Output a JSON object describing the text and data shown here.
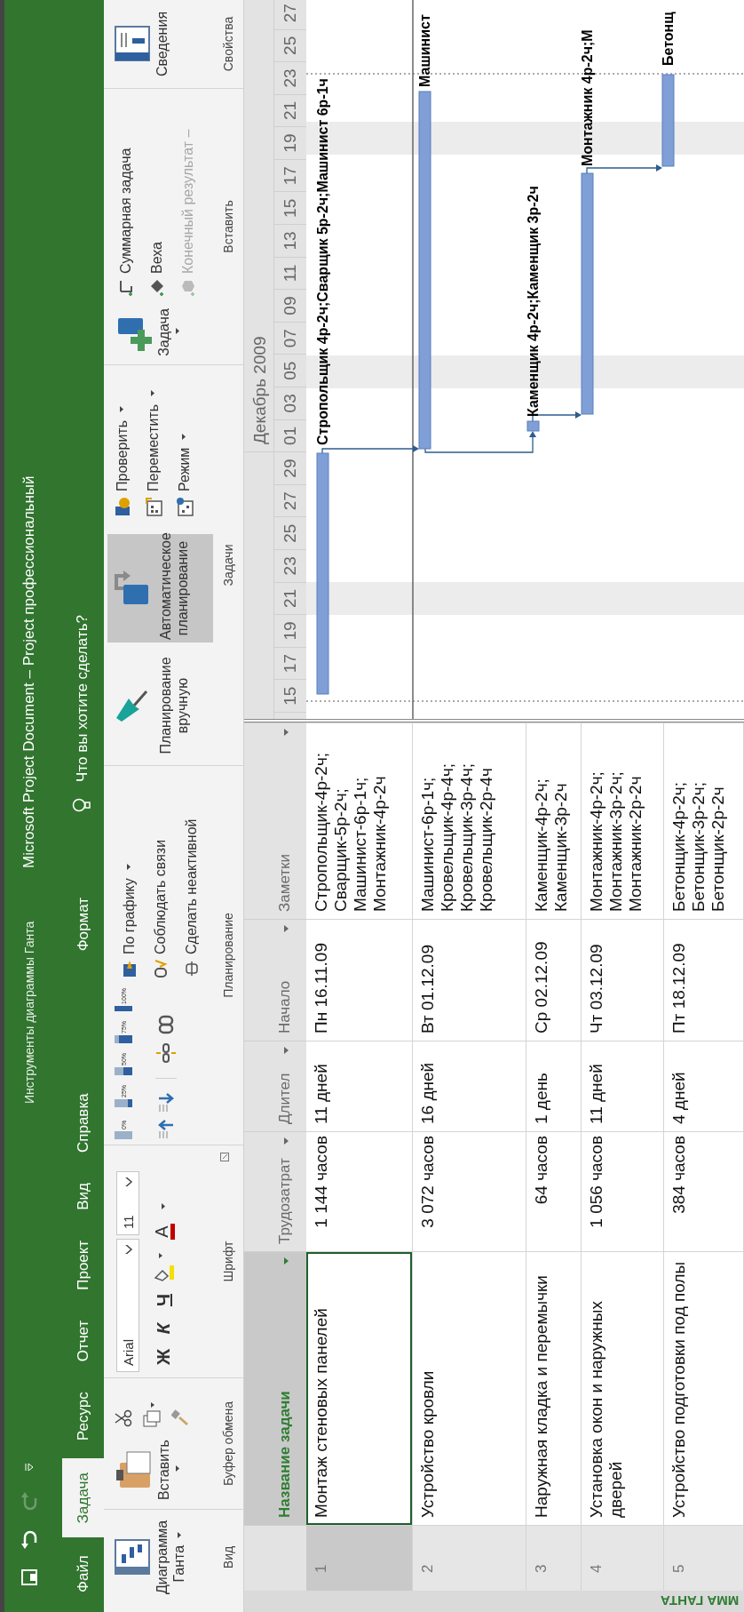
{
  "window": {
    "title": "Microsoft Project Document – Project профессиональный",
    "context_group": "Инструменты диаграммы Ганта"
  },
  "quick_access": [
    {
      "kind": "save",
      "disabled": false
    },
    {
      "kind": "undo",
      "disabled": false
    },
    {
      "kind": "redo",
      "disabled": true
    },
    {
      "kind": "customize",
      "disabled": false
    }
  ],
  "tabs": [
    {
      "label": "Файл",
      "kind": "normal",
      "selected": false
    },
    {
      "label": "Задача",
      "kind": "normal",
      "selected": true
    },
    {
      "label": "Ресурс",
      "kind": "normal",
      "selected": false
    },
    {
      "label": "Отчет",
      "kind": "normal",
      "selected": false
    },
    {
      "label": "Проект",
      "kind": "normal",
      "selected": false
    },
    {
      "label": "Вид",
      "kind": "normal",
      "selected": false
    },
    {
      "label": "Справка",
      "kind": "normal",
      "selected": false
    },
    {
      "label": "Формат",
      "kind": "context",
      "selected": false
    }
  ],
  "search": {
    "placeholder": "Что вы хотите сделать?"
  },
  "ribbon": {
    "view_group": {
      "label": "Вид",
      "gantt_button": "Диаграмма Ганта"
    },
    "clipboard_group": {
      "label": "Буфер обмена",
      "paste_button": "Вставить"
    },
    "font_group": {
      "label": "Шрифт",
      "font_name": "Arial",
      "font_size": "11",
      "bold": "Ж",
      "italic": "К",
      "underline": "Ч",
      "font_color": "A"
    },
    "schedule_group": {
      "label": "Планирование",
      "percent_buttons": [
        "0%",
        "25%",
        "50%",
        "75%",
        "100%"
      ],
      "on_schedule": "По графику",
      "respect_links": "Соблюдать связи",
      "inactivate": "Сделать неактивной"
    },
    "tasks_group": {
      "label": "Задачи",
      "modes": [
        {
          "label": "Планирование вручную",
          "selected": false
        },
        {
          "label": "Автоматическое планирование",
          "selected": true
        }
      ],
      "inspect": "Проверить",
      "move": "Переместить",
      "mode": "Режим"
    },
    "insert_group": {
      "label": "Вставить",
      "task_button": "Задача",
      "summary": "Суммарная задача",
      "milestone": "Веха",
      "deliverable": {
        "label": "Конечный результат –",
        "disabled": true
      }
    },
    "properties_group": {
      "label": "Свойства",
      "information_button": "Сведения"
    }
  },
  "table": {
    "columns": [
      {
        "label": "Название задачи",
        "selected": true
      },
      {
        "label": "Трудозатрат",
        "selected": false
      },
      {
        "label": "Длител",
        "selected": false
      },
      {
        "label": "Начало",
        "selected": false
      },
      {
        "label": "Заметки",
        "selected": false
      }
    ],
    "rows": [
      {
        "id": "1",
        "name": "Монтаж стеновых панелей",
        "work": "1 144 часов",
        "duration": "11 дней",
        "start": "Пн 16.11.09",
        "notes": "Стропольщик-4р-2ч;\nСварщик-5р-2ч;\nМашинист-6р-1ч;\nМонтажник-4р-2ч",
        "selected": true
      },
      {
        "id": "2",
        "name": "Устройство кровли",
        "work": "3 072 часов",
        "duration": "16 дней",
        "start": "Вт 01.12.09",
        "notes": "Машинист-6р-1ч;\nКровельщик-4р-4ч;\nКровельщик-3р-4ч;\nКровельщик-2р-4ч",
        "selected": false
      },
      {
        "id": "3",
        "name": "Наружная кладка и перемычки",
        "work": "64 часов",
        "duration": "1 день",
        "start": "Ср 02.12.09",
        "notes": "Каменщик-4р-2ч;\nКаменщик-3р-2ч",
        "selected": false
      },
      {
        "id": "4",
        "name": "Установка окон и наружных дверей",
        "work": "1 056 часов",
        "duration": "11 дней",
        "start": "Чт 03.12.09",
        "notes": "Монтажник-4р-2ч;\nМонтажник-3р-2ч;\nМонтажник-2р-2ч",
        "selected": false
      },
      {
        "id": "5",
        "name": "Устройство подготовки под полы",
        "work": "384 часов",
        "duration": "4 дней",
        "start": "Пт 18.12.09",
        "notes": "Бетонщик-4р-2ч;\nБетонщик-3р-2ч;\nБетонщик-2р-2ч",
        "selected": false
      }
    ]
  },
  "timescale": {
    "month": "Декабрь 2009",
    "days": [
      "15",
      "17",
      "19",
      "21",
      "23",
      "25",
      "27",
      "29",
      "01",
      "03",
      "05",
      "07",
      "09",
      "11",
      "13",
      "15",
      "17",
      "19",
      "21",
      "23",
      "25",
      "27"
    ]
  },
  "bars": [
    {
      "label": "Стропольщик 4р-2ч;Сварщик 5р-2ч;Машинист 6р-1ч"
    },
    {
      "label": "Машинист"
    },
    {
      "label": "Каменщик 4р-2ч;Каменщик 3р-2ч"
    },
    {
      "label": "Монтажник 4р-2ч;М"
    },
    {
      "label": "Бетонщ"
    }
  ],
  "view_bar": {
    "label": "ММА ГАНТА"
  }
}
